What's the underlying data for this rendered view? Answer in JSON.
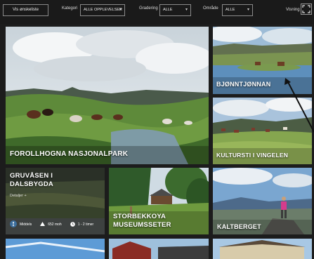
{
  "toolbar": {
    "wishlist_label": "Vis ønskeliste",
    "category_label": "Kategori",
    "category_value": "ALLE OPPLEVELSER",
    "grading_label": "Gradering",
    "grading_value": "ALLE",
    "area_label": "Område",
    "area_value": "ALLE",
    "view_label": "Visning"
  },
  "tiles": {
    "forollhogna": "FOROLLHOGNA NASJONALPARK",
    "bjonntjonnan": "BJØNNTJØNNAN",
    "kultursti": "KULTURSTI I VINGELEN",
    "gruvasen_line1": "GRUVÅSEN I",
    "gruvasen_line2": "DALSBYGDA",
    "gruvasen_details": "Detaljer +",
    "gruvasen_grade": "Middels",
    "gruvasen_elevation": "652 moh",
    "gruvasen_time": "1 - 2 timer",
    "storbekk_line1": "STORBEKKOYA",
    "storbekk_line2": "MUSEUMSSETER",
    "kaltberget": "KALTBERGET"
  },
  "icons": {
    "view_toggle": "fullscreen-icon",
    "grade": "hiker-icon",
    "elevation": "mountain-icon",
    "time": "clock-icon"
  },
  "colors": {
    "background": "#1c1c1c",
    "toolbar": "#1a1a1a",
    "text": "#ffffff",
    "accent_badge": "#3c6e9c"
  }
}
